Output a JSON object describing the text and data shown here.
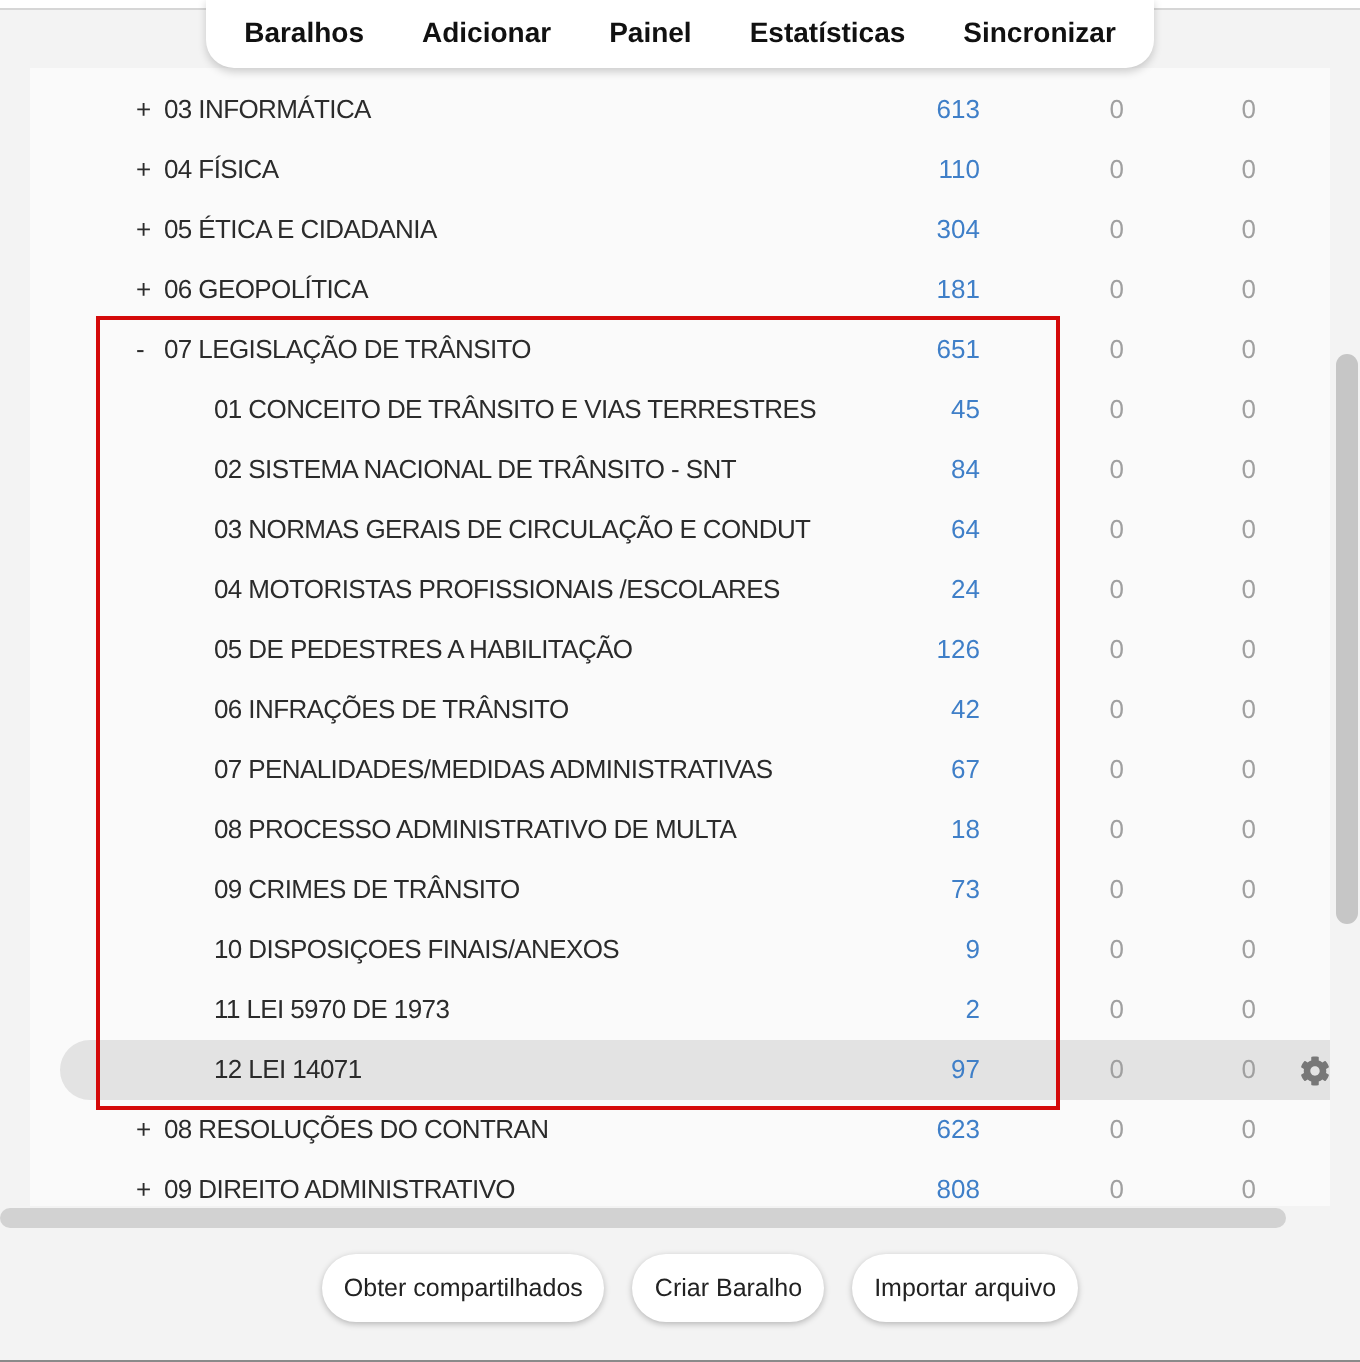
{
  "toolbar": [
    "Baralhos",
    "Adicionar",
    "Painel",
    "Estatísticas",
    "Sincronizar"
  ],
  "decks": [
    {
      "toggle": "+",
      "name": "03 INFORMÁTICA",
      "counts": [
        "613",
        "0",
        "0"
      ],
      "selected": false,
      "annotated": false
    },
    {
      "toggle": "+",
      "name": "04 FÍSICA",
      "counts": [
        "110",
        "0",
        "0"
      ],
      "selected": false,
      "annotated": false
    },
    {
      "toggle": "+",
      "name": "05 ÉTICA E CIDADANIA",
      "counts": [
        "304",
        "0",
        "0"
      ],
      "selected": false,
      "annotated": false
    },
    {
      "toggle": "+",
      "name": "06 GEOPOLÍTICA",
      "counts": [
        "181",
        "0",
        "0"
      ],
      "selected": false,
      "annotated": false
    },
    {
      "toggle": "-",
      "name": "07 LEGISLAÇÃO DE TRÂNSITO",
      "counts": [
        "651",
        "0",
        "0"
      ],
      "selected": false,
      "annotated": true,
      "children": [
        {
          "name": "01 CONCEITO DE TRÂNSITO E VIAS TERRESTRES",
          "counts": [
            "45",
            "0",
            "0"
          ],
          "selected": false
        },
        {
          "name": "02 SISTEMA NACIONAL DE TRÂNSITO - SNT",
          "counts": [
            "84",
            "0",
            "0"
          ],
          "selected": false
        },
        {
          "name": "03 NORMAS GERAIS DE CIRCULAÇÃO E CONDUT",
          "counts": [
            "64",
            "0",
            "0"
          ],
          "selected": false
        },
        {
          "name": "04 MOTORISTAS PROFISSIONAIS /ESCOLARES",
          "counts": [
            "24",
            "0",
            "0"
          ],
          "selected": false
        },
        {
          "name": "05 DE PEDESTRES A HABILITAÇÃO",
          "counts": [
            "126",
            "0",
            "0"
          ],
          "selected": false
        },
        {
          "name": "06 INFRAÇÕES DE TRÂNSITO",
          "counts": [
            "42",
            "0",
            "0"
          ],
          "selected": false
        },
        {
          "name": "07 PENALIDADES/MEDIDAS ADMINISTRATIVAS",
          "counts": [
            "67",
            "0",
            "0"
          ],
          "selected": false
        },
        {
          "name": "08 PROCESSO ADMINISTRATIVO DE MULTA",
          "counts": [
            "18",
            "0",
            "0"
          ],
          "selected": false
        },
        {
          "name": "09 CRIMES DE TRÂNSITO",
          "counts": [
            "73",
            "0",
            "0"
          ],
          "selected": false
        },
        {
          "name": "10 DISPOSIÇOES FINAIS/ANEXOS",
          "counts": [
            "9",
            "0",
            "0"
          ],
          "selected": false
        },
        {
          "name": "11 LEI 5970 DE 1973",
          "counts": [
            "2",
            "0",
            "0"
          ],
          "selected": false
        },
        {
          "name": "12 LEI 14071",
          "counts": [
            "97",
            "0",
            "0"
          ],
          "selected": true
        }
      ]
    },
    {
      "toggle": "+",
      "name": "08 RESOLUÇÕES DO CONTRAN",
      "counts": [
        "623",
        "0",
        "0"
      ],
      "selected": false,
      "annotated": false
    },
    {
      "toggle": "+",
      "name": "09 DIREITO ADMINISTRATIVO",
      "counts": [
        "808",
        "0",
        "0"
      ],
      "selected": false,
      "annotated": false
    }
  ],
  "buttons": [
    "Obter compartilhados",
    "Criar Baralho",
    "Importar arquivo"
  ]
}
